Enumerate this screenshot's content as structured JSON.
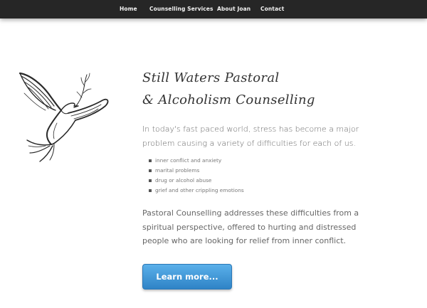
{
  "nav": {
    "items": [
      {
        "label": "Home"
      },
      {
        "label": "Counselling Services"
      },
      {
        "label": "About Joan"
      },
      {
        "label": "Contact"
      }
    ]
  },
  "hero": {
    "logo_icon": "dove-icon",
    "title_line1": "Still Waters Pastoral",
    "title_line2": "& Alcoholism Counselling",
    "intro": "In today's fast paced world, stress has become a major problem causing a variety of difficulties for each of us.",
    "bullets": [
      "inner conflict and anxiety",
      "marital problems",
      "drug or alcohol abuse",
      "grief and other crippling emotions"
    ],
    "body": "Pastoral Counselling addresses these difficulties from a spiritual perspective, offered to hurting and distressed people who are looking for relief from inner conflict.",
    "cta_label": "Learn more..."
  },
  "colors": {
    "nav_bg": "#262626",
    "nav_text": "#f2f2f2",
    "cta_top": "#5ab0ea",
    "cta_bottom": "#2f83c6"
  }
}
